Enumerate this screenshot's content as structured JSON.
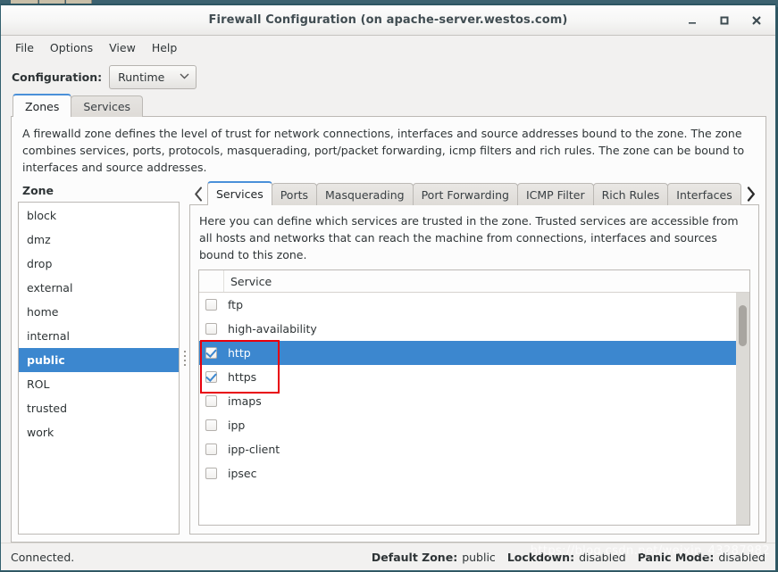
{
  "window": {
    "title": "Firewall Configuration (on apache-server.westos.com)",
    "minimize_label": "_",
    "maximize_label": "□",
    "close_label": "✕"
  },
  "menubar": {
    "items": [
      {
        "label": "File"
      },
      {
        "label": "Options"
      },
      {
        "label": "View"
      },
      {
        "label": "Help"
      }
    ]
  },
  "toolbar": {
    "configuration_label": "Configuration:",
    "configuration_value": "Runtime",
    "configuration_chevron": "⌄"
  },
  "primary_tabs": [
    {
      "label": "Zones",
      "active": true
    },
    {
      "label": "Services",
      "active": false
    }
  ],
  "zone_description": "A firewalld zone defines the level of trust for network connections, interfaces and source addresses bound to the zone. The zone combines services, ports, protocols, masquerading, port/packet forwarding, icmp filters and rich rules. The zone can be bound to interfaces and source addresses.",
  "zone_panel": {
    "heading": "Zone",
    "items": [
      {
        "label": "block",
        "selected": false
      },
      {
        "label": "dmz",
        "selected": false
      },
      {
        "label": "drop",
        "selected": false
      },
      {
        "label": "external",
        "selected": false
      },
      {
        "label": "home",
        "selected": false
      },
      {
        "label": "internal",
        "selected": false
      },
      {
        "label": "public",
        "selected": true
      },
      {
        "label": "ROL",
        "selected": false
      },
      {
        "label": "trusted",
        "selected": false
      },
      {
        "label": "work",
        "selected": false
      }
    ]
  },
  "sub_tabs": {
    "prev_arrow": "‹",
    "next_arrow": "›",
    "items": [
      {
        "label": "Services",
        "active": true
      },
      {
        "label": "Ports",
        "active": false
      },
      {
        "label": "Masquerading",
        "active": false
      },
      {
        "label": "Port Forwarding",
        "active": false
      },
      {
        "label": "ICMP Filter",
        "active": false
      },
      {
        "label": "Rich Rules",
        "active": false
      },
      {
        "label": "Interfaces",
        "active": false
      }
    ]
  },
  "service_panel": {
    "description": "Here you can define which services are trusted in the zone. Trusted services are accessible from all hosts and networks that can reach the machine from connections, interfaces and sources bound to this zone.",
    "column_header": "Service",
    "rows": [
      {
        "name": "ftp",
        "checked": false,
        "selected": false
      },
      {
        "name": "high-availability",
        "checked": false,
        "selected": false
      },
      {
        "name": "http",
        "checked": true,
        "selected": true
      },
      {
        "name": "https",
        "checked": true,
        "selected": false
      },
      {
        "name": "imaps",
        "checked": false,
        "selected": false
      },
      {
        "name": "ipp",
        "checked": false,
        "selected": false
      },
      {
        "name": "ipp-client",
        "checked": false,
        "selected": false
      },
      {
        "name": "ipsec",
        "checked": false,
        "selected": false
      }
    ]
  },
  "statusbar": {
    "connection": "Connected.",
    "default_zone_label": "Default Zone:",
    "default_zone_value": "public",
    "lockdown_label": "Lockdown:",
    "lockdown_value": "disabled",
    "panic_label": "Panic Mode:",
    "panic_value": "disabled"
  },
  "watermark": "https://blog.csdn.net/weixin_43287982",
  "colors": {
    "selection_blue": "#3c87cf",
    "tab_accent": "#4a90d9",
    "annotation_red": "#e8000b",
    "window_chrome": "#f2f1f0",
    "desktop": "#3c6270"
  }
}
